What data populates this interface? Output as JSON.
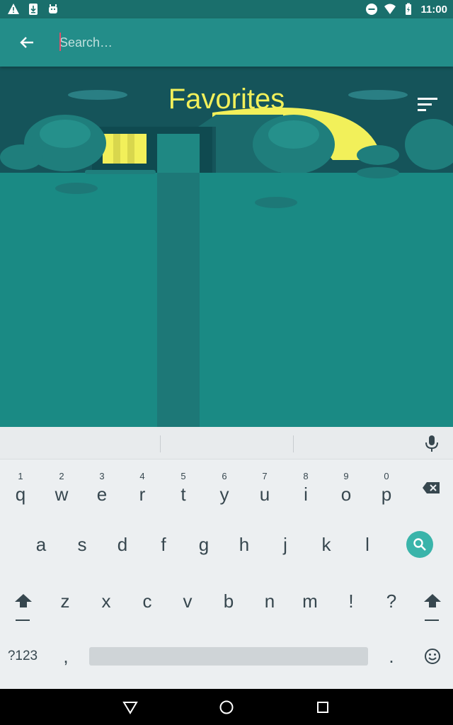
{
  "status_bar": {
    "time": "11:00",
    "left_icons": [
      "warning-icon",
      "download-icon",
      "android-icon"
    ],
    "right_icons": [
      "do-not-disturb-icon",
      "wifi-icon",
      "battery-icon"
    ]
  },
  "app_bar": {
    "back_icon": "arrow-back-icon",
    "search_placeholder": "Search…",
    "search_value": ""
  },
  "header": {
    "title": "Favorites",
    "sort_icon": "sort-icon"
  },
  "colors": {
    "status_bar": "#1a6f6c",
    "app_bar": "#238d89",
    "content": "#1a8a84",
    "title": "#f2f05a",
    "keyboard_bg": "#eceff1",
    "search_key": "#3ab4aa"
  },
  "keyboard": {
    "row1": [
      {
        "letter": "q",
        "hint": "1"
      },
      {
        "letter": "w",
        "hint": "2"
      },
      {
        "letter": "e",
        "hint": "3"
      },
      {
        "letter": "r",
        "hint": "4"
      },
      {
        "letter": "t",
        "hint": "5"
      },
      {
        "letter": "y",
        "hint": "6"
      },
      {
        "letter": "u",
        "hint": "7"
      },
      {
        "letter": "i",
        "hint": "8"
      },
      {
        "letter": "o",
        "hint": "9"
      },
      {
        "letter": "p",
        "hint": "0"
      }
    ],
    "row2": [
      "a",
      "s",
      "d",
      "f",
      "g",
      "h",
      "j",
      "k",
      "l"
    ],
    "row3": [
      "z",
      "x",
      "c",
      "v",
      "b",
      "n",
      "m",
      "!",
      "?"
    ],
    "symbols_label": "?123",
    "comma": ",",
    "period": "."
  },
  "nav_bar": {
    "icons": [
      "back-triangle-icon",
      "home-circle-icon",
      "recents-square-icon"
    ]
  }
}
